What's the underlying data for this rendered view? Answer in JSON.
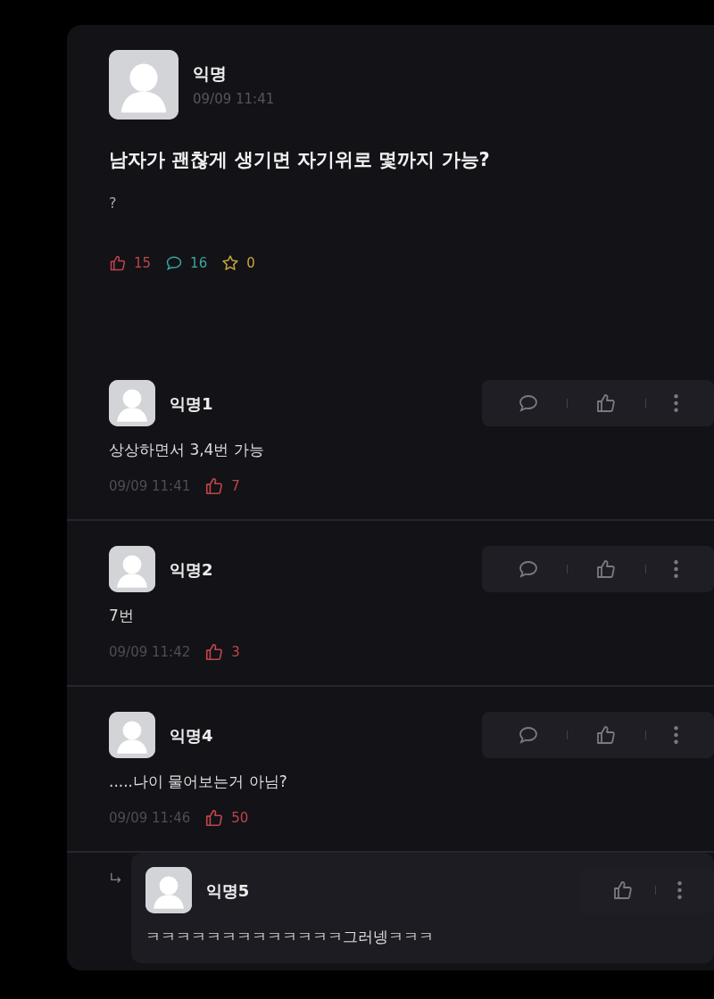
{
  "post": {
    "author": "익명",
    "time": "09/09 11:41",
    "title": "남자가 괜찮게 생기면 자기위로 몇까지 가능?",
    "body": "?",
    "likes": "15",
    "comments": "16",
    "scraps": "0"
  },
  "comments": [
    {
      "author": "익명1",
      "text": "상상하면서 3,4번 가능",
      "time": "09/09 11:41",
      "likes": "7",
      "reply": false
    },
    {
      "author": "익명2",
      "text": "7번",
      "time": "09/09 11:42",
      "likes": "3",
      "reply": false
    },
    {
      "author": "익명4",
      "text": ".....나이 물어보는거 아님?",
      "time": "09/09 11:46",
      "likes": "50",
      "reply": false
    },
    {
      "author": "익명5",
      "text": "ㅋㅋㅋㅋㅋㅋㅋㅋㅋㅋㅋㅋㅋ그러넹ㅋㅋㅋ",
      "reply": true
    }
  ]
}
